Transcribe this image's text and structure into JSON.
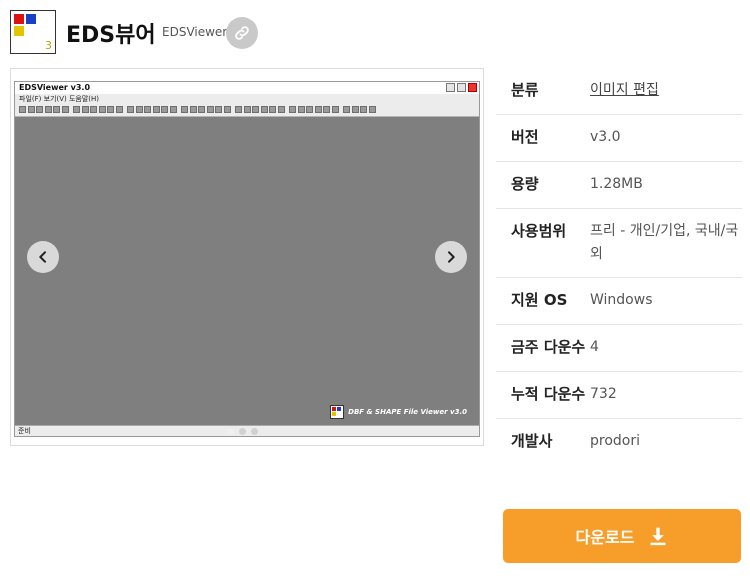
{
  "app": {
    "name": "EDS뷰어",
    "subtitle": "EDSViewer",
    "logo_number": "3"
  },
  "screenshot": {
    "window_title": "EDSViewer v3.0",
    "menu": "파일(F)  보기(V)  도움말(H)",
    "status": "준비",
    "watermark": "DBF & SHAPE File Viewer v3.0"
  },
  "info": [
    {
      "label": "분류",
      "value": "이미지 편집"
    },
    {
      "label": "버전",
      "value": "v3.0"
    },
    {
      "label": "용량",
      "value": "1.28MB"
    },
    {
      "label": "사용범위",
      "value": "프리 - 개인/기업, 국내/국외"
    },
    {
      "label": "지원 OS",
      "value": "Windows"
    },
    {
      "label": "금주 다운수",
      "value": "4"
    },
    {
      "label": "누적 다운수",
      "value": "732"
    },
    {
      "label": "개발사",
      "value": "prodori"
    }
  ],
  "download": {
    "label": "다운로드"
  },
  "colors": {
    "accent": "#f79d29",
    "screenshot_bg": "#7f7f7f"
  },
  "icons": {
    "link": "link-icon",
    "prev": "chevron-left-icon",
    "next": "chevron-right-icon",
    "download": "download-icon"
  }
}
